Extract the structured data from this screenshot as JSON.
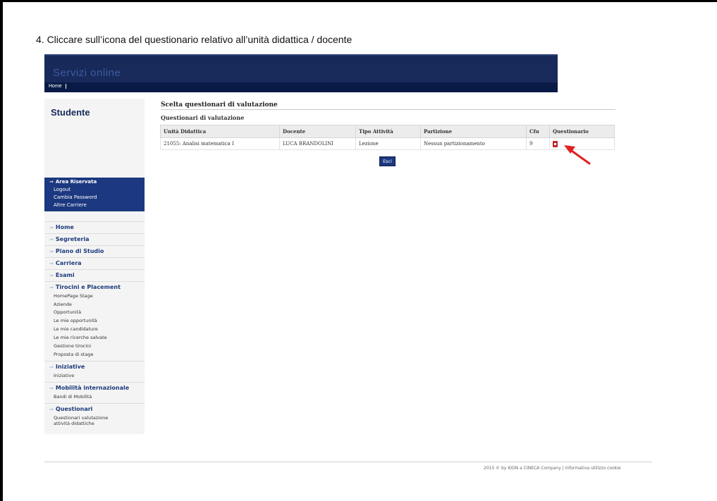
{
  "instruction": "4. Cliccare sull’icona del questionario relativo all’unità didattica / docente",
  "banner": {
    "title": "Servizi online"
  },
  "navbar": {
    "home": "Home"
  },
  "sidebar": {
    "title": "Studente",
    "reserved": {
      "heading": "Area Riservata",
      "items": [
        "Logout",
        "Cambia Password",
        "Altre Carriere"
      ]
    },
    "menus": [
      {
        "label": "Home",
        "subs": []
      },
      {
        "label": "Segreteria",
        "subs": []
      },
      {
        "label": "Piano di Studio",
        "subs": []
      },
      {
        "label": "Carriera",
        "subs": []
      },
      {
        "label": "Esami",
        "subs": []
      },
      {
        "label": "Tirocini e Placement",
        "subs": [
          "HomePage Stage",
          "Aziende",
          "Opportunità",
          "Le mie opportunità",
          "Le mie candidature",
          "Le mie ricerche salvate",
          "Gestione tirocini",
          "Proposta di stage"
        ]
      },
      {
        "label": "Iniziative",
        "subs": [
          "Iniziative"
        ]
      },
      {
        "label": "Mobilità internazionale",
        "subs": [
          "Bandi di Mobilità"
        ]
      },
      {
        "label": "Questionari",
        "subs": [
          "Questionari valutazione",
          "attività didattiche"
        ]
      }
    ]
  },
  "main": {
    "title": "Scelta questionari di valutazione",
    "subtitle": "Questionari di valutazione",
    "table": {
      "headers": [
        "Unità Didattica",
        "Docente",
        "Tipo Attività",
        "Partizione",
        "Cfu",
        "Questionario"
      ],
      "rows": [
        [
          "21055: Analisi matematica I",
          "LUCA BRANDOLINI",
          "Lezione",
          "Nessun partizionamento",
          "9",
          ""
        ]
      ]
    },
    "exit_label": "Esci"
  },
  "footer": {
    "text": "2015 © by KION a CINECA Company | Informativa utilizzo cookie"
  },
  "colors": {
    "banner": "#172a5a",
    "reserved": "#1c3880",
    "pdf_icon": "#c0262c",
    "arrow": "#e02020"
  },
  "icons": {
    "pdf": "pdf-file-icon",
    "callout": "red-arrow-annotation"
  }
}
